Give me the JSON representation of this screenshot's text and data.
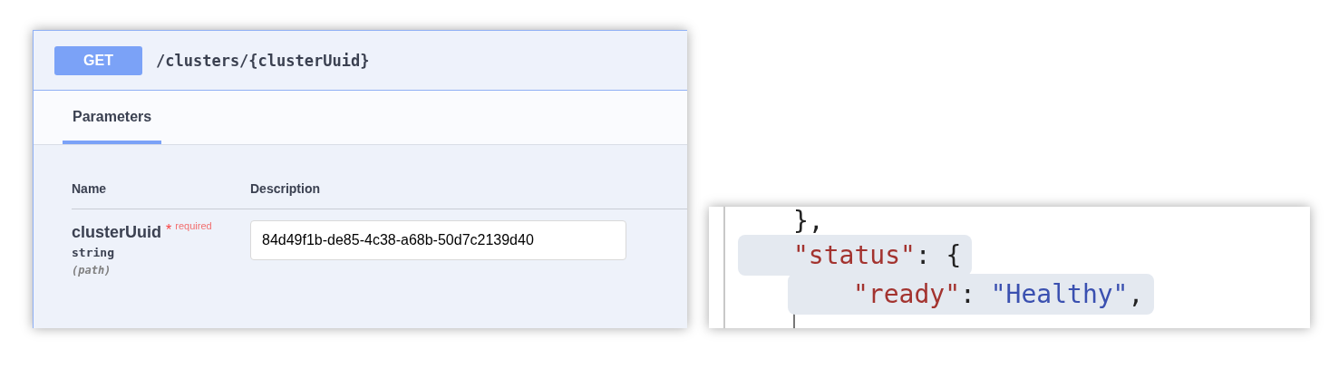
{
  "operation": {
    "method": "GET",
    "path": "/clusters/{clusterUuid}"
  },
  "tabs": [
    {
      "label": "Parameters",
      "selected": true
    }
  ],
  "table": {
    "columns": [
      "Name",
      "Description"
    ],
    "rows": [
      {
        "name": "clusterUuid",
        "required_mark": "*",
        "required_label": "required",
        "type": "string",
        "location": "(path)",
        "value": "84d49f1b-de85-4c38-a68b-50d7c2139d40"
      }
    ]
  },
  "code": {
    "lines": [
      {
        "highlighted": false,
        "tokens": [
          {
            "kind": "punct",
            "text": "},"
          }
        ]
      },
      {
        "highlighted": true,
        "tokens": [
          {
            "kind": "key",
            "text": "\"status\""
          },
          {
            "kind": "punct",
            "text": ": {"
          }
        ],
        "children": [
          {
            "highlighted": true,
            "tokens": [
              {
                "kind": "key",
                "text": "\"ready\""
              },
              {
                "kind": "punct",
                "text": ": "
              },
              {
                "kind": "string",
                "text": "\"Healthy\""
              },
              {
                "kind": "punct",
                "text": ","
              }
            ]
          }
        ]
      }
    ]
  }
}
